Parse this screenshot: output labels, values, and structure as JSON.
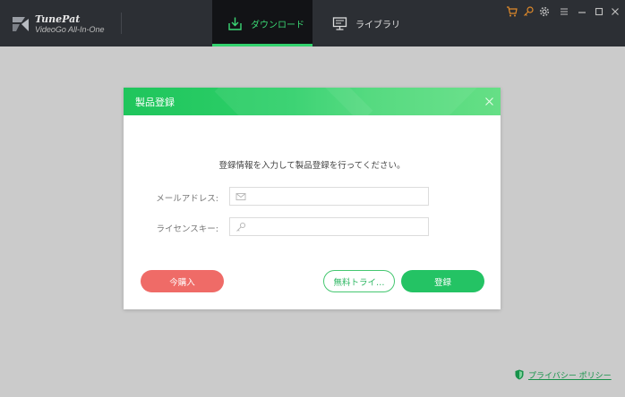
{
  "app": {
    "name": "TunePat",
    "subtitle": "VideoGo All-In-One"
  },
  "tabs": [
    {
      "label": "ダウンロード",
      "active": true
    },
    {
      "label": "ライブラリ",
      "active": false
    }
  ],
  "window_controls": [
    "cart-icon",
    "key-icon",
    "gear-icon",
    "menu-icon",
    "minimize-icon",
    "maximize-icon",
    "close-icon"
  ],
  "colors": {
    "accent": "#32d26e",
    "buy": "#ef6b67",
    "register": "#24c364",
    "titlebar": "#2c2f34",
    "cart_icon": "#e08a2a"
  },
  "dialog": {
    "title": "製品登録",
    "instruction": "登録情報を入力して製品登録を行ってください。",
    "email_label": "メールアドレス:",
    "email_value": "",
    "license_label": "ライセンスキー:",
    "license_value": "",
    "buy_label": "今購入",
    "trial_label": "無料トライ…",
    "register_label": "登録"
  },
  "footer": {
    "privacy_label": "プライバシー ポリシー"
  }
}
